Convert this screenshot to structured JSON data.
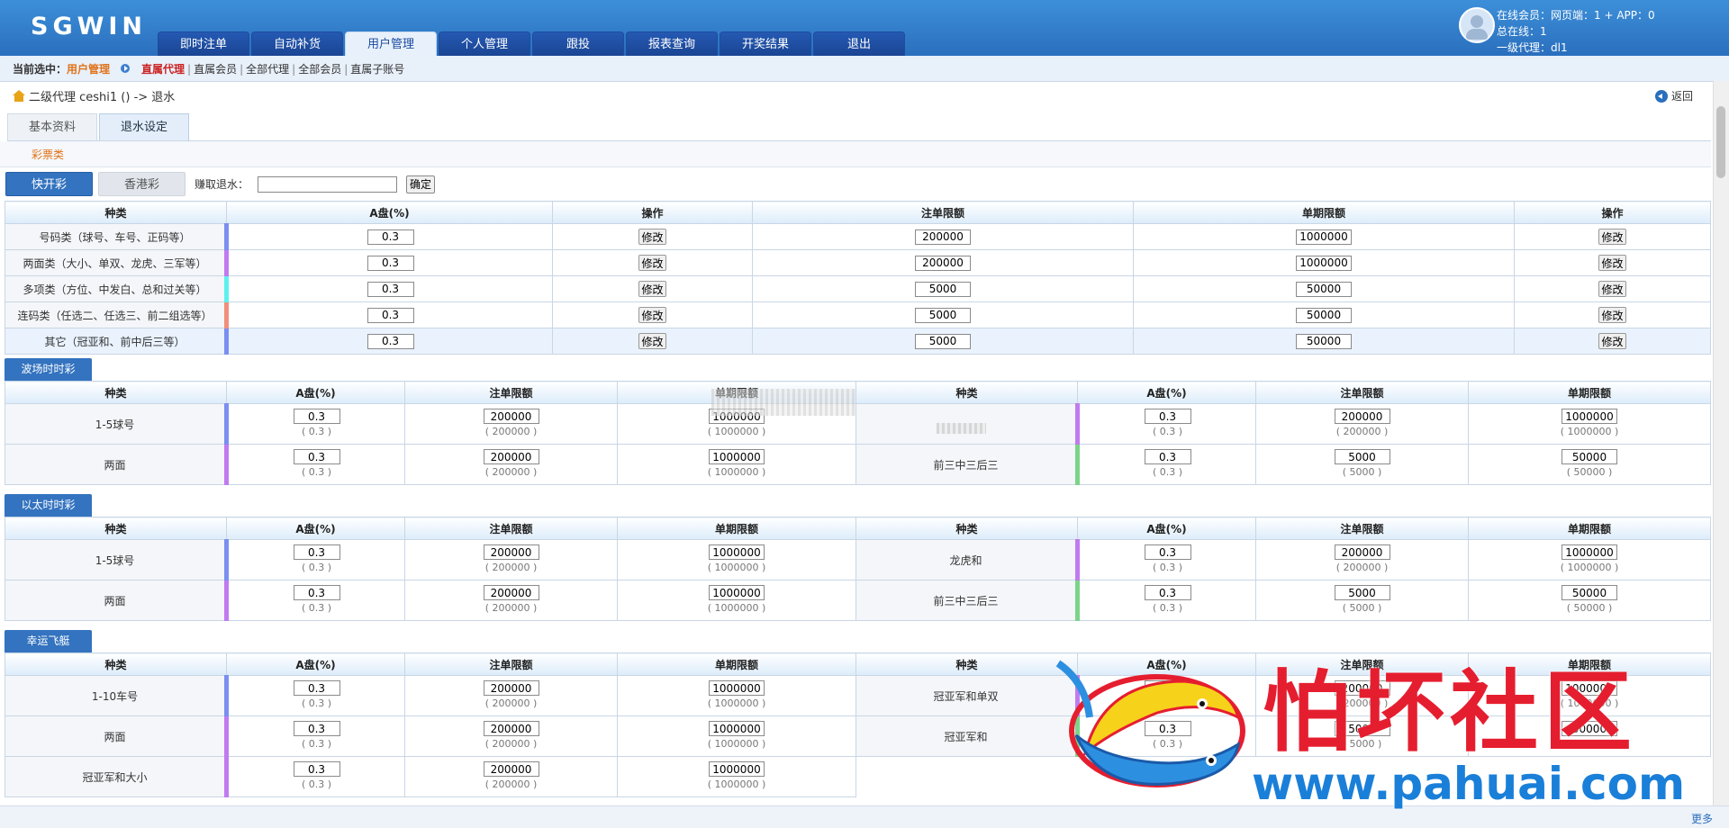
{
  "app": {
    "logo": "SGWIN",
    "nav": [
      "即时注单",
      "自动补货",
      "用户管理",
      "个人管理",
      "跟投",
      "报表查询",
      "开奖结果",
      "退出"
    ],
    "nav_active_index": 2,
    "user": {
      "line1": "在线会员：网页端：1 + APP：0",
      "line2": "总在线：1",
      "line3": "一级代理：dl1"
    }
  },
  "subbar": {
    "label": "当前选中：",
    "module": "用户管理",
    "links": [
      "直属代理",
      "直属会员",
      "全部代理",
      "全部会员",
      "直属子账号"
    ]
  },
  "breadcrumb": {
    "text": "二级代理 ceshi1  ()   -> 退水",
    "back": "返回"
  },
  "tabs": [
    "基本资料",
    "退水设定"
  ],
  "active_tab": 1,
  "category": "彩票类",
  "lottery_tabs": [
    "快开彩",
    "香港彩"
  ],
  "earn_label": "赚取退水：",
  "confirm": "确定",
  "main_table": {
    "headers": [
      "种类",
      "A盘(%)",
      "操作",
      "注单限额",
      "单期限额",
      "操作"
    ],
    "modify": "修改",
    "colors": [
      "#7b8ff0",
      "#c07bef",
      "#5ef0f0",
      "#f08f7b",
      "#7b8ff0"
    ],
    "rows": [
      {
        "kind": "号码类（球号、车号、正码等）",
        "a": "0.3",
        "bet": "200000",
        "period": "1000000"
      },
      {
        "kind": "两面类（大小、单双、龙虎、三军等）",
        "a": "0.3",
        "bet": "200000",
        "period": "1000000"
      },
      {
        "kind": "多项类（方位、中发白、总和过关等）",
        "a": "0.3",
        "bet": "5000",
        "period": "50000"
      },
      {
        "kind": "连码类（任选二、任选三、前二组选等）",
        "a": "0.3",
        "bet": "5000",
        "period": "50000"
      },
      {
        "kind": "其它（冠亚和、前中后三等）",
        "a": "0.3",
        "bet": "5000",
        "period": "50000"
      }
    ]
  },
  "sections": [
    {
      "title": "波场时时彩",
      "headers": [
        "种类",
        "A盘(%)",
        "注单限额",
        "单期限额",
        "种类",
        "A盘(%)",
        "注单限额",
        "单期限额"
      ],
      "rows": [
        [
          {
            "kind": "1-5球号",
            "a": "0.3",
            "a_sub": "( 0.3 )",
            "bet": "200000",
            "bet_sub": "( 200000 )",
            "period": "1000000",
            "period_sub": "( 1000000 )",
            "color": "#7b8ff0"
          },
          {
            "kind": "",
            "a": "0.3",
            "a_sub": "( 0.3 )",
            "bet": "200000",
            "bet_sub": "( 200000 )",
            "period": "1000000",
            "period_sub": "( 1000000 )",
            "color": "#c07bef"
          }
        ],
        [
          {
            "kind": "两面",
            "a": "0.3",
            "a_sub": "( 0.3 )",
            "bet": "200000",
            "bet_sub": "( 200000 )",
            "period": "1000000",
            "period_sub": "( 1000000 )",
            "color": "#c07bef"
          },
          {
            "kind": "前三中三后三",
            "a": "0.3",
            "a_sub": "( 0.3 )",
            "bet": "5000",
            "bet_sub": "( 5000 )",
            "period": "50000",
            "period_sub": "( 50000 )",
            "color": "#7bd48a"
          }
        ]
      ]
    },
    {
      "title": "以太时时彩",
      "headers": [
        "种类",
        "A盘(%)",
        "注单限额",
        "单期限额",
        "种类",
        "A盘(%)",
        "注单限额",
        "单期限额"
      ],
      "rows": [
        [
          {
            "kind": "1-5球号",
            "a": "0.3",
            "a_sub": "( 0.3 )",
            "bet": "200000",
            "bet_sub": "( 200000 )",
            "period": "1000000",
            "period_sub": "( 1000000 )",
            "color": "#7b8ff0"
          },
          {
            "kind": "龙虎和",
            "a": "0.3",
            "a_sub": "( 0.3 )",
            "bet": "200000",
            "bet_sub": "( 200000 )",
            "period": "1000000",
            "period_sub": "( 1000000 )",
            "color": "#c07bef"
          }
        ],
        [
          {
            "kind": "两面",
            "a": "0.3",
            "a_sub": "( 0.3 )",
            "bet": "200000",
            "bet_sub": "( 200000 )",
            "period": "1000000",
            "period_sub": "( 1000000 )",
            "color": "#c07bef"
          },
          {
            "kind": "前三中三后三",
            "a": "0.3",
            "a_sub": "( 0.3 )",
            "bet": "5000",
            "bet_sub": "( 5000 )",
            "period": "50000",
            "period_sub": "( 50000 )",
            "color": "#7bd48a"
          }
        ]
      ]
    },
    {
      "title": "幸运飞艇",
      "headers": [
        "种类",
        "A盘(%)",
        "注单限额",
        "单期限额",
        "种类",
        "A盘(%)",
        "注单限额",
        "单期限额"
      ],
      "rows": [
        [
          {
            "kind": "1-10车号",
            "a": "0.3",
            "a_sub": "( 0.3 )",
            "bet": "200000",
            "bet_sub": "( 200000 )",
            "period": "1000000",
            "period_sub": "( 1000000 )",
            "color": "#7b8ff0"
          },
          {
            "kind": "冠亚军和单双",
            "a": "0.3",
            "a_sub": "( 0.3 )",
            "bet": "200000",
            "bet_sub": "( 200000 )",
            "period": "1000000",
            "period_sub": "( 1000000 )",
            "color": "#c07bef"
          }
        ],
        [
          {
            "kind": "两面",
            "a": "0.3",
            "a_sub": "( 0.3 )",
            "bet": "200000",
            "bet_sub": "( 200000 )",
            "period": "1000000",
            "period_sub": "( 1000000 )",
            "color": "#c07bef"
          },
          {
            "kind": "冠亚军和",
            "a": "0.3",
            "a_sub": "( 0.3 )",
            "bet": "5000",
            "bet_sub": "( 5000 )",
            "period": "50000",
            "period_sub": "( 50000 )",
            "color": "#7bd48a"
          }
        ],
        [
          {
            "kind": "冠亚军和大小",
            "a": "0.3",
            "a_sub": "( 0.3 )",
            "bet": "200000",
            "bet_sub": "( 200000 )",
            "period": "1000000",
            "period_sub": "( 1000000 )",
            "color": "#c07bef"
          },
          null
        ]
      ]
    }
  ],
  "footer": {
    "more": "更多"
  },
  "watermark": {
    "title": "怕坏社区",
    "url": "www.pahuai.com"
  }
}
